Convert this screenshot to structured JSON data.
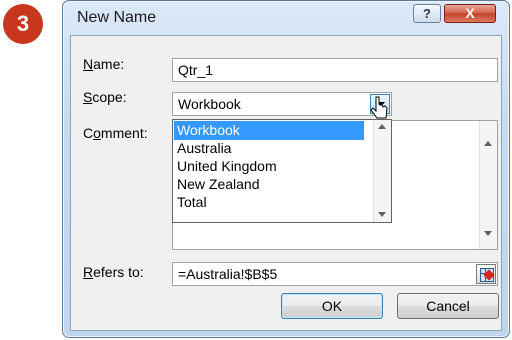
{
  "step_badge": "3",
  "dialog": {
    "title": "New Name",
    "help_label": "?",
    "close_label": "X"
  },
  "form": {
    "name_label": {
      "access_key": "N",
      "rest": "ame:"
    },
    "name_value": "Qtr_1",
    "scope_label": {
      "access_key": "S",
      "rest": "cope:"
    },
    "scope_value": "Workbook",
    "comment_label": {
      "pre": "C",
      "access_key": "o",
      "rest": "mment:"
    },
    "scope_options": [
      "Workbook",
      "Australia",
      "United Kingdom",
      "New Zealand",
      "Total"
    ],
    "scope_selected_index": 0,
    "refers_label": {
      "access_key": "R",
      "rest": "efers to:"
    },
    "refers_value": "=Australia!$B$5"
  },
  "buttons": {
    "ok": "OK",
    "cancel": "Cancel"
  },
  "colors": {
    "badge": "#c8361d",
    "selection": "#3399ff",
    "close_button": "#c24328"
  }
}
